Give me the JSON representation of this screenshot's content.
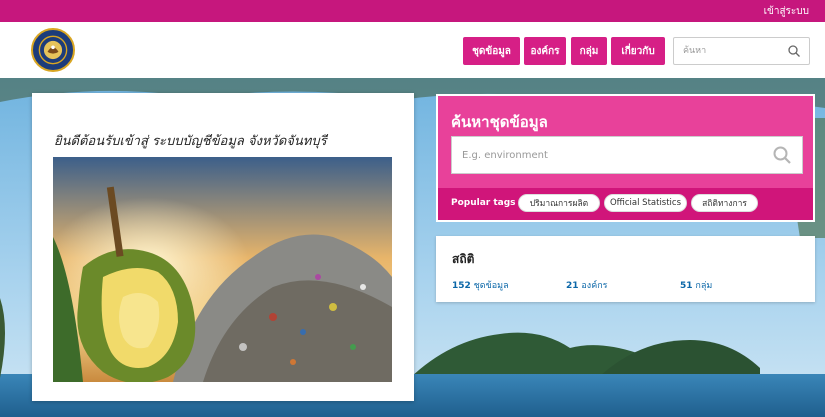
{
  "topbar": {
    "login_label": "เข้าสู่ระบบ"
  },
  "header": {
    "logo_icon": "provincial-seal",
    "nav": [
      {
        "label": "ชุดข้อมูล"
      },
      {
        "label": "องค์กร"
      },
      {
        "label": "กลุ่ม"
      },
      {
        "label": "เกี่ยวกับ"
      }
    ],
    "search_placeholder": "ค้นหา"
  },
  "welcome": {
    "title": "ยินดีต้อนรับเข้าสู่ ระบบบัญชีข้อมูล จังหวัดจันทบุรี"
  },
  "dataset_search": {
    "title": "ค้นหาชุดข้อมูล",
    "placeholder": "E.g. environment",
    "popular_tags_label": "Popular tags",
    "tags": [
      {
        "label": "ปริมาณการผลิต"
      },
      {
        "label": "Official Statistics"
      },
      {
        "label": "สถิติทางการ"
      }
    ]
  },
  "stats": {
    "title": "สถิติ",
    "items": [
      {
        "count": "152",
        "label": "ชุดข้อมูล"
      },
      {
        "count": "21",
        "label": "องค์กร"
      },
      {
        "count": "51",
        "label": "กลุ่ม"
      }
    ]
  },
  "colors": {
    "topbar": "#c6177d",
    "nav_button": "#d61f86",
    "search_panel": "#e8419a",
    "tags_bar": "#d0157a",
    "link": "#0b67a8"
  }
}
